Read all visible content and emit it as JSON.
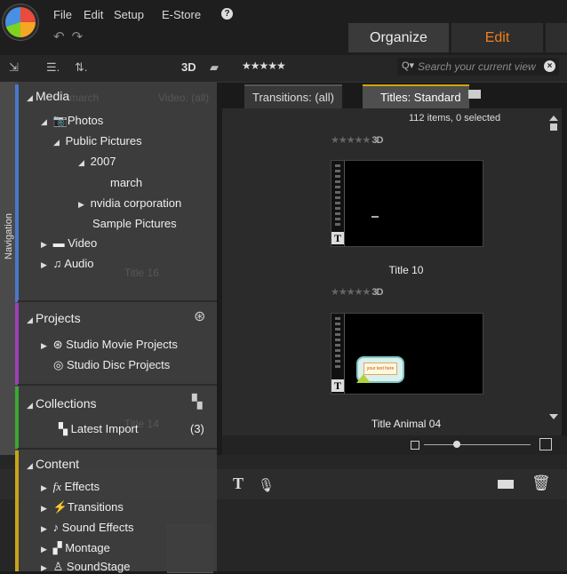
{
  "menu": [
    "File",
    "Edit",
    "Setup",
    "E-Store"
  ],
  "modes": {
    "organize": "Organize",
    "edit": "Edit"
  },
  "toolbar": {
    "view_label": "3D",
    "rating": "★★★★★",
    "search_placeholder": "Search your current view"
  },
  "tabs": {
    "transitions": "Transitions: (all)",
    "titles": "Titles: Standard",
    "close": "×"
  },
  "browser": {
    "status": "112 items, 0 selected",
    "items": [
      {
        "stars": "★★★★★",
        "badge": "3D",
        "title": "Title 10"
      },
      {
        "stars": "★★★★★",
        "badge": "3D",
        "title": "Title Animal 04",
        "thumb_text": "your text here"
      }
    ]
  },
  "navigator": {
    "label": "Navigation",
    "media": {
      "title": "Media",
      "items": [
        "Photos",
        "Public Pictures",
        "2007",
        "march",
        "nvidia corporation",
        "Sample Pictures",
        "Video",
        "Audio"
      ]
    },
    "projects": {
      "title": "Projects",
      "items": [
        "Studio Movie Projects",
        "Studio Disc Projects"
      ]
    },
    "collections": {
      "title": "Collections",
      "items": [
        {
          "label": "Latest Import",
          "count": "(3)"
        }
      ]
    },
    "content": {
      "title": "Content",
      "items": [
        "Effects",
        "Transitions",
        "Sound Effects",
        "Montage",
        "SoundStage"
      ]
    }
  },
  "ghost_text": {
    "march": "march",
    "video_all": "Video: (all)",
    "title16": "Title 16",
    "title14": "Title 14"
  },
  "colors": {
    "media": "#4a78c8",
    "projects": "#9b3fb8",
    "collections": "#3aa832",
    "content": "#c8a418",
    "edit_accent": "#f07f1f"
  }
}
